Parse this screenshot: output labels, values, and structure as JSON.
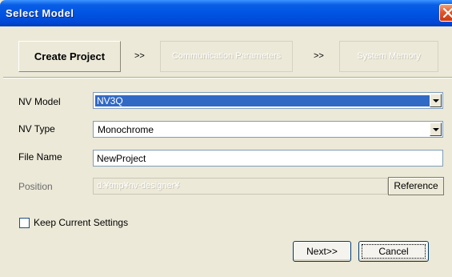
{
  "window": {
    "title": "Select Model",
    "close_icon": "close-icon"
  },
  "steps": {
    "step1": "Create Project",
    "arrow1": ">>",
    "step2": "Communication Parameters",
    "arrow2": ">>",
    "step3": "System Memory"
  },
  "form": {
    "nv_model_label": "NV Model",
    "nv_model_value": "NV3Q",
    "nv_type_label": "NV Type",
    "nv_type_value": "Monochrome",
    "file_name_label": "File Name",
    "file_name_value": "NewProject",
    "position_label": "Position",
    "position_value": "d:¥tmp¥nv-designer¥",
    "reference_button": "Reference",
    "keep_settings_label": "Keep Current Settings",
    "keep_settings_checked": false
  },
  "buttons": {
    "next": "Next>>",
    "cancel": "Cancel"
  },
  "colors": {
    "titlebar": "#0054e3",
    "selection": "#316ac5",
    "close": "#e2562a",
    "face": "#ece9d8"
  }
}
